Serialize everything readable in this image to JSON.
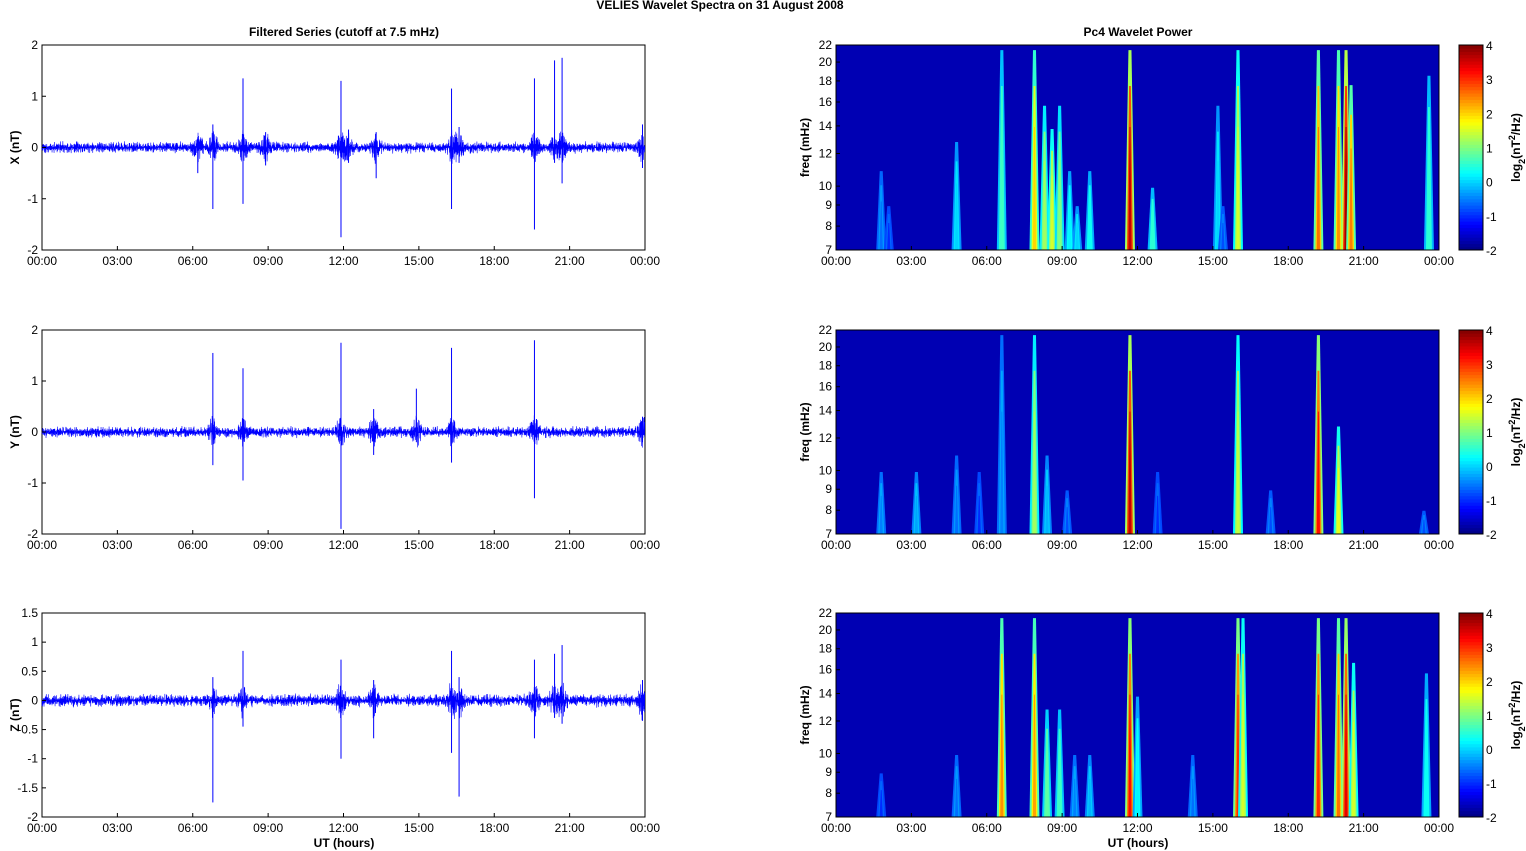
{
  "chart_data": {
    "title": "VELIES Wavelet Spectra on 31 August    2008",
    "type": "line",
    "x_tick_labels": [
      "00:00",
      "03:00",
      "06:00",
      "09:00",
      "12:00",
      "15:00",
      "18:00",
      "21:00",
      "00:00"
    ],
    "xlim_hours": [
      0,
      24
    ],
    "xlabel": "UT (hours)",
    "time_series": {
      "title": "Filtered Series (cutoff at 7.5 mHz)",
      "panels": [
        {
          "ylabel": "X (nT)",
          "ylim": [
            -2,
            2
          ],
          "yticks": [
            -2,
            -1,
            0,
            1,
            2
          ],
          "ytick_labels": [
            "-2",
            "-1",
            "0",
            "1",
            "2"
          ],
          "noise_level": 0.09,
          "color": "#0000ff",
          "spikes": [
            [
              6.8,
              0.45,
              -1.2
            ],
            [
              6.2,
              0.2,
              -0.5
            ],
            [
              8.0,
              1.35,
              -1.1
            ],
            [
              8.9,
              0.3,
              -0.35
            ],
            [
              11.9,
              1.3,
              -1.75
            ],
            [
              12.2,
              0.35,
              -0.3
            ],
            [
              13.3,
              0.3,
              -0.6
            ],
            [
              16.3,
              1.15,
              -1.2
            ],
            [
              16.6,
              0.4,
              -0.3
            ],
            [
              19.6,
              1.35,
              -1.6
            ],
            [
              20.4,
              1.7,
              -0.3
            ],
            [
              20.7,
              1.75,
              -0.7
            ],
            [
              23.9,
              0.45,
              -0.4
            ]
          ]
        },
        {
          "ylabel": "Y (nT)",
          "ylim": [
            -2,
            2
          ],
          "yticks": [
            -2,
            -1,
            0,
            1,
            2
          ],
          "ytick_labels": [
            "-2",
            "-1",
            "0",
            "1",
            "2"
          ],
          "noise_level": 0.09,
          "color": "#0000ff",
          "spikes": [
            [
              6.8,
              1.55,
              -0.65
            ],
            [
              8.0,
              1.25,
              -0.95
            ],
            [
              11.9,
              1.75,
              -1.9
            ],
            [
              13.2,
              0.45,
              -0.45
            ],
            [
              14.9,
              0.85,
              -0.2
            ],
            [
              16.3,
              1.65,
              -0.6
            ],
            [
              19.6,
              1.8,
              -1.3
            ],
            [
              23.9,
              0.3,
              -0.2
            ]
          ]
        },
        {
          "ylabel": "Z (nT)",
          "ylim": [
            -2,
            1.5
          ],
          "yticks": [
            -2,
            -1.5,
            -1,
            -0.5,
            0,
            0.5,
            1,
            1.5
          ],
          "ytick_labels": [
            "-2",
            "-1.5",
            "-1",
            "-0.5",
            "0",
            "0.5",
            "1",
            "1.5"
          ],
          "noise_level": 0.09,
          "color": "#0000ff",
          "spikes": [
            [
              6.8,
              0.4,
              -1.75
            ],
            [
              8.0,
              0.85,
              -0.45
            ],
            [
              11.9,
              0.7,
              -1.0
            ],
            [
              13.2,
              0.35,
              -0.65
            ],
            [
              16.3,
              0.85,
              -0.9
            ],
            [
              16.6,
              0.4,
              -1.65
            ],
            [
              19.6,
              0.7,
              -0.65
            ],
            [
              20.4,
              0.8,
              -0.3
            ],
            [
              20.7,
              0.95,
              -0.4
            ],
            [
              23.9,
              0.35,
              -0.35
            ]
          ]
        }
      ]
    },
    "wavelet": {
      "title": "Pc4 Wavelet Power",
      "type": "heatmap",
      "ylabel": "freq (mHz)",
      "yscale": "log",
      "ylim": [
        7,
        22
      ],
      "yticks": [
        7,
        8,
        9,
        10,
        12,
        14,
        16,
        18,
        20,
        22
      ],
      "ytick_labels": [
        "7",
        "8",
        "9",
        "10",
        "12",
        "14",
        "16",
        "18",
        "20",
        "22"
      ],
      "colorbar": {
        "label": "log2(nT^2/Hz)",
        "label_main": "log",
        "label_sub": "2",
        "label_rest1": "(nT",
        "label_sup": "2",
        "label_rest2": "/Hz)",
        "range": [
          -2,
          4
        ],
        "ticks": [
          "-2",
          "-1",
          "0",
          "1",
          "2",
          "3",
          "4"
        ]
      },
      "panels": [
        {
          "events": [
            [
              1.8,
              -0.6,
              11
            ],
            [
              2.1,
              -1,
              9
            ],
            [
              4.8,
              0,
              13
            ],
            [
              6.6,
              0.6,
              22
            ],
            [
              7.9,
              2,
              22
            ],
            [
              8.3,
              1.2,
              16
            ],
            [
              8.6,
              1.5,
              14
            ],
            [
              8.9,
              1,
              16
            ],
            [
              9.3,
              0.2,
              11
            ],
            [
              9.6,
              0,
              9
            ],
            [
              10.1,
              0.3,
              11
            ],
            [
              11.7,
              3.6,
              22
            ],
            [
              12.6,
              0.5,
              10
            ],
            [
              15.2,
              0,
              16
            ],
            [
              15.4,
              -0.8,
              9
            ],
            [
              16.0,
              1.5,
              22
            ],
            [
              19.2,
              2.6,
              22
            ],
            [
              20.0,
              2.4,
              22
            ],
            [
              20.3,
              3.8,
              22
            ],
            [
              20.5,
              2.5,
              18
            ],
            [
              23.6,
              0.5,
              19
            ]
          ]
        },
        {
          "events": [
            [
              1.8,
              -0.5,
              10
            ],
            [
              3.2,
              -0.3,
              10
            ],
            [
              4.8,
              -0.6,
              11
            ],
            [
              5.7,
              -1,
              10
            ],
            [
              6.6,
              -0.5,
              22
            ],
            [
              7.9,
              1.2,
              22
            ],
            [
              8.4,
              -0.2,
              11
            ],
            [
              9.2,
              -0.8,
              9
            ],
            [
              11.7,
              3.6,
              22
            ],
            [
              12.8,
              -1,
              10
            ],
            [
              16.0,
              1.4,
              22
            ],
            [
              17.3,
              -0.8,
              9
            ],
            [
              19.2,
              3.2,
              22
            ],
            [
              20.0,
              1.6,
              13
            ],
            [
              23.4,
              -0.8,
              8
            ]
          ]
        },
        {
          "events": [
            [
              1.8,
              -1,
              9
            ],
            [
              4.8,
              -0.6,
              10
            ],
            [
              6.6,
              2.4,
              22
            ],
            [
              7.9,
              2.3,
              22
            ],
            [
              8.4,
              0.8,
              13
            ],
            [
              8.9,
              0.6,
              13
            ],
            [
              9.5,
              -0.5,
              10
            ],
            [
              10.1,
              -0.2,
              10
            ],
            [
              11.7,
              3.2,
              22
            ],
            [
              12.0,
              0.2,
              14
            ],
            [
              14.2,
              -0.6,
              10
            ],
            [
              16.0,
              3.0,
              22
            ],
            [
              16.2,
              1.5,
              22
            ],
            [
              19.2,
              3.0,
              22
            ],
            [
              20.0,
              2.6,
              22
            ],
            [
              20.3,
              3.4,
              22
            ],
            [
              20.6,
              1.5,
              17
            ],
            [
              23.5,
              0.3,
              16
            ]
          ]
        }
      ]
    }
  }
}
